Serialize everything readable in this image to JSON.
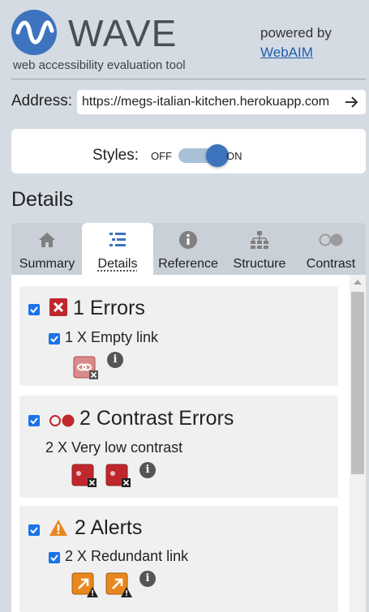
{
  "header": {
    "logo_title": "WAVE",
    "subtitle": "web accessibility evaluation tool",
    "powered_by": "powered by",
    "webaim_link": "WebAIM"
  },
  "address": {
    "label": "Address:",
    "value": "https://megs-italian-kitchen.herokuapp.com"
  },
  "styles": {
    "label": "Styles:",
    "off": "OFF",
    "on": "ON",
    "state": "on"
  },
  "details_heading": "Details",
  "tabs": [
    {
      "label": "Summary",
      "icon": "home-icon"
    },
    {
      "label": "Details",
      "icon": "list-icon",
      "active": true
    },
    {
      "label": "Reference",
      "icon": "info-circle-icon"
    },
    {
      "label": "Structure",
      "icon": "sitemap-icon"
    },
    {
      "label": "Contrast",
      "icon": "contrast-icon"
    }
  ],
  "categories": [
    {
      "title": "1 Errors",
      "icon": "error-x-icon",
      "items": [
        {
          "label": "1 X Empty link",
          "instances": 1
        }
      ]
    },
    {
      "title": "2 Contrast Errors",
      "icon": "contrast-icon",
      "items": [
        {
          "label": "2 X Very low contrast",
          "instances": 2
        }
      ]
    },
    {
      "title": "2 Alerts",
      "icon": "alert-triangle-icon",
      "items": [
        {
          "label": "2 X Redundant link",
          "instances": 2
        }
      ]
    }
  ],
  "colors": {
    "brand_blue": "#3d74bd",
    "error_red": "#c0272d",
    "alert_orange": "#e8871e",
    "background": "#d5dbe2"
  }
}
